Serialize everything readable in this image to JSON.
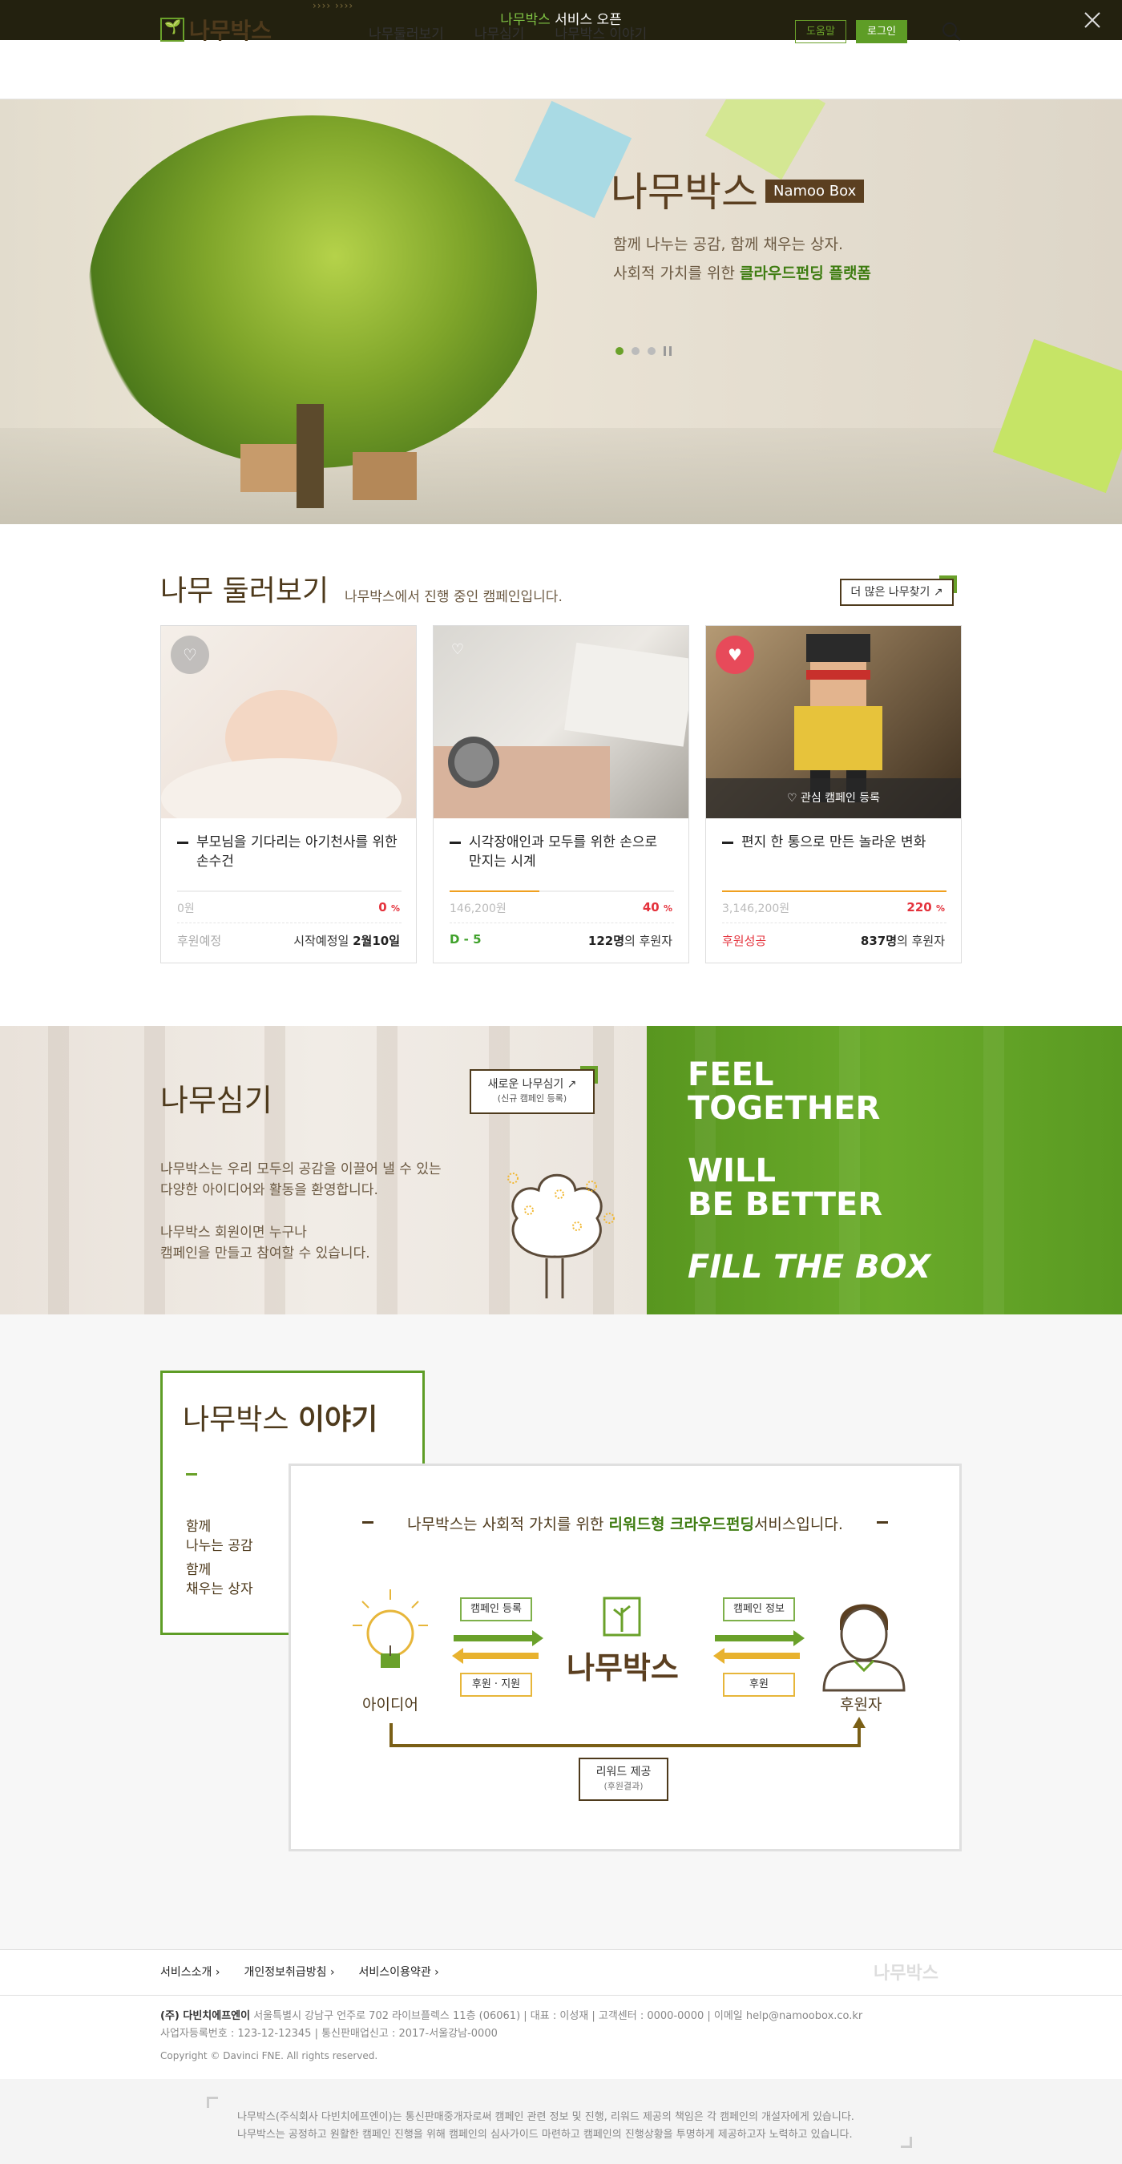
{
  "topbar": {
    "highlight": "나무박스",
    "text": " 서비스 오픈",
    "close_icon": "close-icon"
  },
  "header": {
    "logo_text": "나무박스",
    "nav": [
      "나무둘러보기",
      "나무심기",
      "나무박스 이야기"
    ],
    "help_label": "도움말",
    "login_label": "로그인",
    "search_icon": "search-icon"
  },
  "hero": {
    "title": "나무박스",
    "tag": "Namoo Box",
    "sub1": "함께 나누는 공감, 함께 채우는 상자.",
    "sub2_prefix": "사회적 가치를 위한 ",
    "sub2_bold": "클라우드펀딩 플랫폼"
  },
  "browse": {
    "title": "나무 둘러보기",
    "subtitle": "나무박스에서 진행 중인 캠페인입니다.",
    "more_label": "더 많은 나무찾기 ↗",
    "cards": [
      {
        "title": "부모님을 기다리는 아기천사를 위한 손수건",
        "amount": "0원",
        "percent": "0",
        "progress": 0,
        "status": "후원예정",
        "status_color": "#aaaaaa",
        "right_prefix": "시작예정일 ",
        "right_bold": "2월10일",
        "right_suffix": "",
        "bar_color": "#eeeeee"
      },
      {
        "title": "시각장애인과 모두를 위한 손으로 만지는 시계",
        "amount": "146,200원",
        "percent": "40",
        "progress": 0.4,
        "status": "D - 5",
        "status_color": "#3fa12a",
        "right_prefix": "",
        "right_bold": "122명",
        "right_suffix": "의 후원자",
        "bar_color": "#f0a020"
      },
      {
        "title": "편지 한 통으로 만든 놀라운 변화",
        "amount": "3,146,200원",
        "percent": "220",
        "progress": 1,
        "status": "후원성공",
        "status_color": "#e4323c",
        "right_prefix": "",
        "right_bold": "837명",
        "right_suffix": "의 후원자",
        "bar_color": "#f0a020",
        "overlay": "♡  관심 캠페인 등록"
      }
    ],
    "percent_unit": "%"
  },
  "plant": {
    "title": "나무심기",
    "p1a": "나무박스는 우리 모두의 공감을 이끌어 낼 수 있는",
    "p1b": "다양한 아이디어와 활동을 환영합니다.",
    "p2a": "나무박스 회원이면 누구나",
    "p2b": "캠페인을 만들고 참여할 수 있습니다.",
    "btn_label": "새로운 나무심기 ↗",
    "btn_sub": "(신규 캠페인 등록)",
    "slogan": [
      "FEEL",
      "TOGETHER",
      "WILL",
      "BE BETTER",
      "FILL THE BOX"
    ]
  },
  "story": {
    "title_a": "나무박스 ",
    "title_b": "이야기",
    "t1": "함께",
    "t2": "나누는 공감",
    "t3": "함께",
    "t4": "채우는 상자",
    "head_prefix": "나무박스는 사회적 가치를 위한 ",
    "head_bold": "리워드형 크라우드펀딩",
    "head_suffix": "서비스입니다.",
    "idea": "아이디어",
    "center": "나무박스",
    "supporter": "후원자",
    "pill_campaign_reg": "캠페인 등록",
    "pill_support": "후원 · 지원",
    "pill_campaign_info": "캠페인 정보",
    "pill_support2": "후원",
    "reward": "리워드 제공",
    "reward_sub": "(후원결과)"
  },
  "footer": {
    "nav": [
      "서비스소개 ›",
      "개인정보취급방침 ›",
      "서비스이용약관 ›"
    ],
    "logo": "나무박스",
    "company": "(주) 다빈치에프엔이",
    "info1": "  서울특별시 강남구 언주로 702 라이브플렉스 11층 (06061)  |  대표 : 이성재  |  고객센터 : 0000-0000  |  이메일 help@namoobox.co.kr",
    "info2": "사업자등록번호 : 123-12-12345  |  통신판매업신고 : 2017-서울강남-0000",
    "copyright": "Copyright © Davinci FNE. All rights reserved.",
    "notice1": "나무박스(주식회사 다빈치에프엔이)는 통신판매중개자로써 캠페인 관련 정보 및 진행, 리워드 제공의 책임은 각 캠페인의 개설자에게 있습니다.",
    "notice2": "나무박스는 공정하고 원활한 캠페인 진행을 위해 캠페인의 심사가이드 마련하고 캠페인의 진행상황을 투명하게 제공하고자 노력하고 있습니다."
  }
}
